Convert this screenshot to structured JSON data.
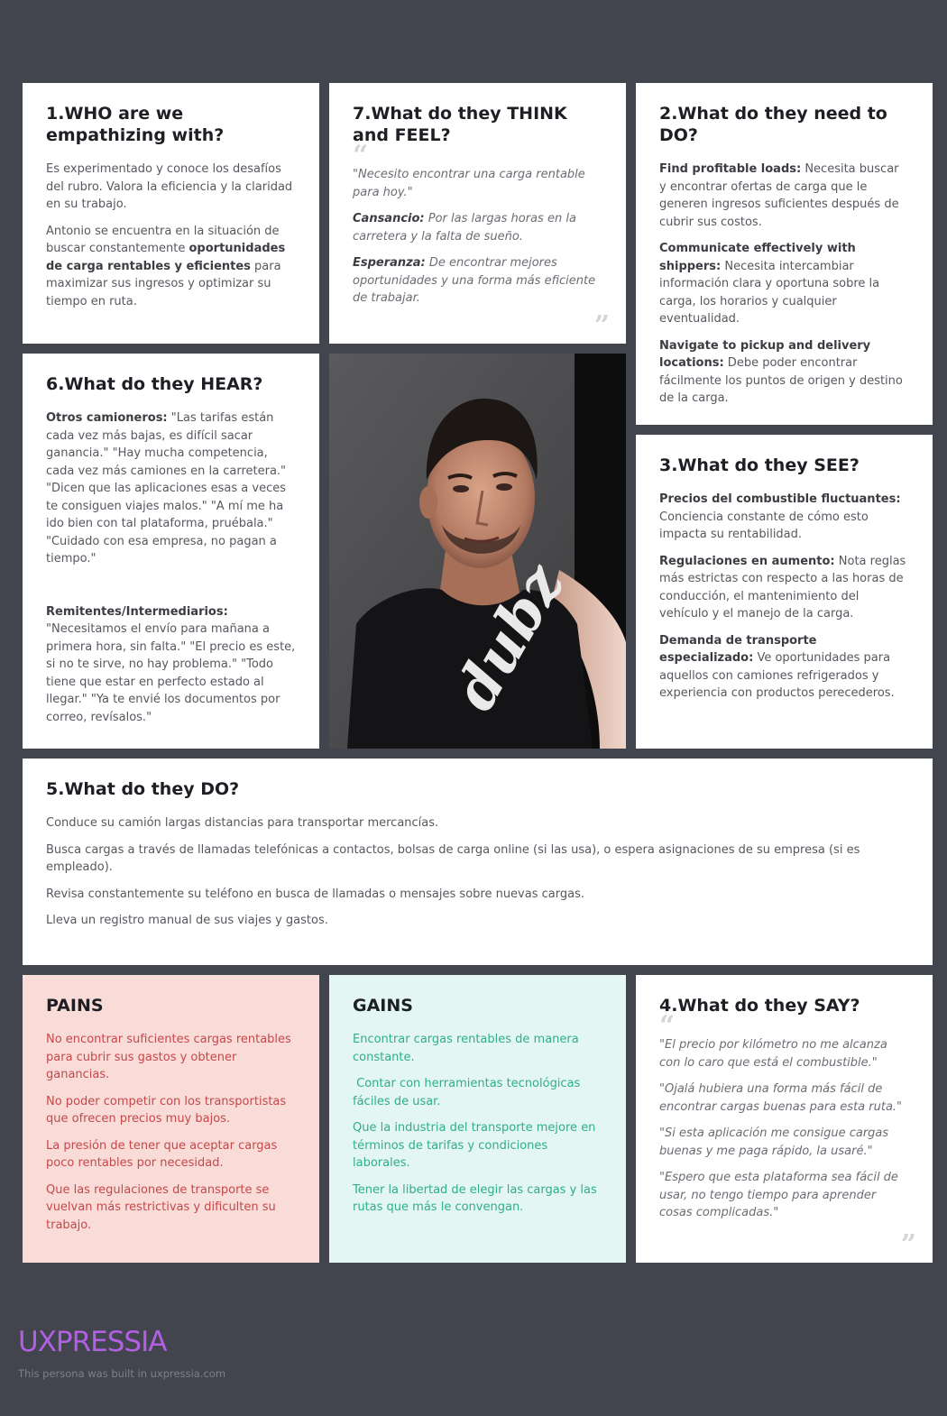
{
  "who": {
    "title": "1.WHO are we empathizing with?",
    "p1": "Es experimentado y conoce los desafíos del rubro. Valora la eficiencia y la claridad en su trabajo.",
    "p2_before": "Antonio se encuentra en la situación de buscar constantemente ",
    "p2_bold": "oportunidades de carga rentables y eficientes",
    "p2_after": " para maximizar sus ingresos y optimizar su tiempo en ruta."
  },
  "think": {
    "title": "7.What do they THINK and FEEL?",
    "quote": "\"Necesito encontrar una carga rentable para hoy.\"",
    "items": [
      {
        "label": "Cansancio:",
        "text": " Por las largas horas en la carretera y la falta de sueño."
      },
      {
        "label": "Esperanza:",
        "text": " De encontrar mejores oportunidades y una forma más eficiente de trabajar."
      }
    ]
  },
  "need": {
    "title": "2.What do they need to DO?",
    "items": [
      {
        "label": "Find profitable loads:",
        "text": " Necesita buscar y encontrar ofertas de carga que le generen ingresos suficientes después de cubrir sus costos."
      },
      {
        "label": "Communicate effectively with shippers:",
        "text": " Necesita intercambiar información clara y oportuna sobre la carga, los horarios y cualquier eventualidad."
      },
      {
        "label": "Navigate to pickup and delivery locations:",
        "text": " Debe poder encontrar fácilmente los puntos de origen y destino de la carga."
      }
    ]
  },
  "hear": {
    "title": "6.What do they HEAR?",
    "items": [
      {
        "label": "Otros camioneros:",
        "text": " \"Las tarifas están cada vez más bajas, es difícil sacar ganancia.\" \"Hay mucha competencia, cada vez más camiones en la carretera.\" \"Dicen que las aplicaciones esas a veces te consiguen viajes malos.\" \"A mí me ha ido bien con tal plataforma, pruébala.\" \"Cuidado con esa empresa, no pagan a tiempo.\""
      },
      {
        "label": "Remitentes/Intermediarios:",
        "text": " \"Necesitamos el envío para mañana a primera hora, sin falta.\" \"El precio es este, si no te sirve, no hay problema.\" \"Todo tiene que estar en perfecto estado al llegar.\" \"Ya te envié los documentos por correo, revísalos.\""
      }
    ]
  },
  "see": {
    "title": "3.What do they SEE?",
    "items": [
      {
        "label": "Precios del combustible fluctuantes:",
        "text": " Conciencia constante de cómo esto impacta su rentabilidad."
      },
      {
        "label": "Regulaciones en aumento:",
        "text": " Nota reglas más estrictas con respecto a las horas de conducción, el mantenimiento del vehículo y el manejo de la carga."
      },
      {
        "label": "Demanda de transporte especializado:",
        "text": " Ve oportunidades para aquellos con camiones refrigerados y experiencia con productos perecederos."
      }
    ]
  },
  "do": {
    "title": "5.What do they DO?",
    "items": [
      "Conduce su camión largas distancias para transportar mercancías.",
      "Busca cargas a través de llamadas telefónicas a contactos, bolsas de carga online (si las usa), o espera asignaciones de su empresa (si es empleado).",
      "Revisa constantemente su teléfono en busca de llamadas o mensajes sobre nuevas cargas.",
      "Lleva un registro manual de sus viajes y gastos."
    ]
  },
  "pains": {
    "title": "PAINS",
    "items": [
      "No encontrar suficientes cargas rentables para cubrir sus gastos y obtener ganancias.",
      "No poder competir con los transportistas que ofrecen precios muy bajos.",
      "La presión de tener que aceptar cargas poco rentables por necesidad.",
      "Que las regulaciones de transporte se vuelvan más restrictivas y dificulten su trabajo."
    ]
  },
  "gains": {
    "title": "GAINS",
    "items": [
      "Encontrar cargas rentables de manera constante.",
      " Contar con herramientas tecnológicas fáciles de usar.",
      "Que la industria del transporte mejore en términos de tarifas y condiciones laborales.",
      "Tener la libertad de elegir las cargas y las rutas que más le convengan."
    ]
  },
  "say": {
    "title": "4.What do they SAY?",
    "items": [
      "\"El precio por kilómetro no me alcanza con lo caro que está el combustible.\"",
      "\"Ojalá hubiera una forma más fácil de encontrar cargas buenas para esta ruta.\"",
      "\"Si esta aplicación me consigue cargas buenas y me paga rápido, la usaré.\"",
      "\"Espero que esta plataforma sea fácil de usar, no tengo tiempo para aprender cosas complicadas.\""
    ]
  },
  "photo": {
    "shirt_text": "dubz"
  },
  "footer": {
    "logo": "UXPRESSIA",
    "note": "This persona was built in uxpressia.com"
  },
  "colors": {
    "background": "#42454d",
    "pains_bg": "#f9dcd8",
    "pains_text": "#c6474a",
    "gains_bg": "#e3f6f1",
    "gains_text": "#2fae8a",
    "logo": "#b15fe3"
  }
}
